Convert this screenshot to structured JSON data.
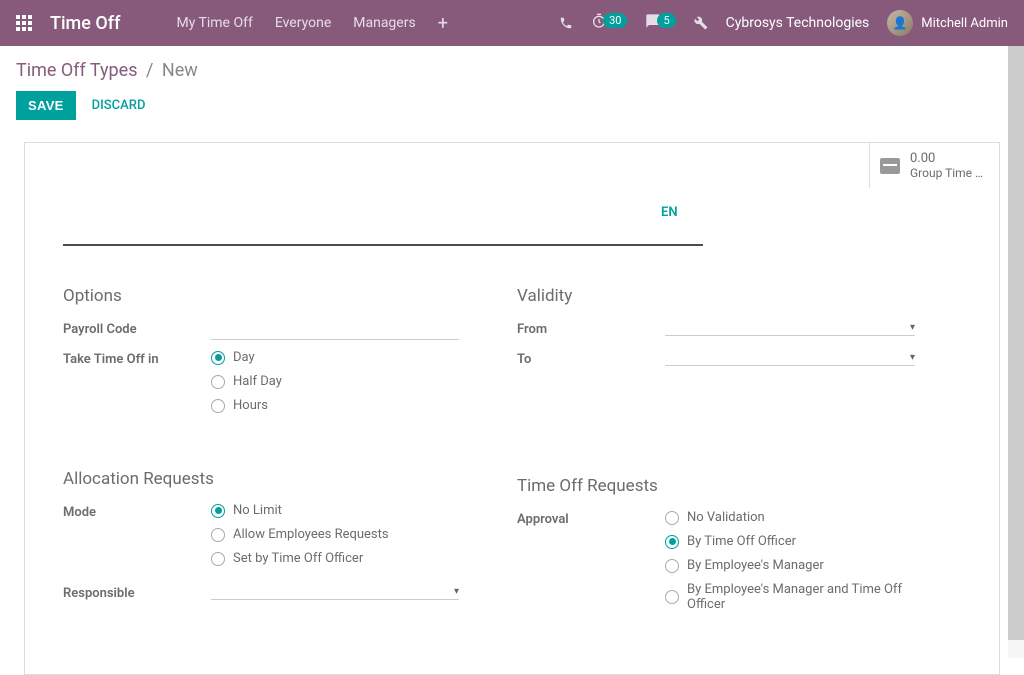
{
  "navbar": {
    "brand": "Time Off",
    "links": [
      "My Time Off",
      "Everyone",
      "Managers"
    ],
    "badge_clock": "30",
    "badge_chat": "5",
    "company": "Cybrosys Technologies",
    "user": "Mitchell Admin"
  },
  "breadcrumb": {
    "root": "Time Off Types",
    "current": "New"
  },
  "actions": {
    "save": "SAVE",
    "discard": "DISCARD"
  },
  "stat": {
    "value": "0.00",
    "label": "Group Time …"
  },
  "title": {
    "lang": "EN",
    "value": ""
  },
  "sections": {
    "options": {
      "heading": "Options",
      "payroll_code_label": "Payroll Code",
      "take_label": "Take Time Off in",
      "take_options": [
        "Day",
        "Half Day",
        "Hours"
      ],
      "take_selected": 0
    },
    "validity": {
      "heading": "Validity",
      "from_label": "From",
      "to_label": "To"
    },
    "allocation": {
      "heading": "Allocation Requests",
      "mode_label": "Mode",
      "mode_options": [
        "No Limit",
        "Allow Employees Requests",
        "Set by Time Off Officer"
      ],
      "mode_selected": 0,
      "responsible_label": "Responsible"
    },
    "requests": {
      "heading": "Time Off Requests",
      "approval_label": "Approval",
      "approval_options": [
        "No Validation",
        "By Time Off Officer",
        "By Employee's Manager",
        "By Employee's Manager and Time Off Officer"
      ],
      "approval_selected": 1
    }
  }
}
